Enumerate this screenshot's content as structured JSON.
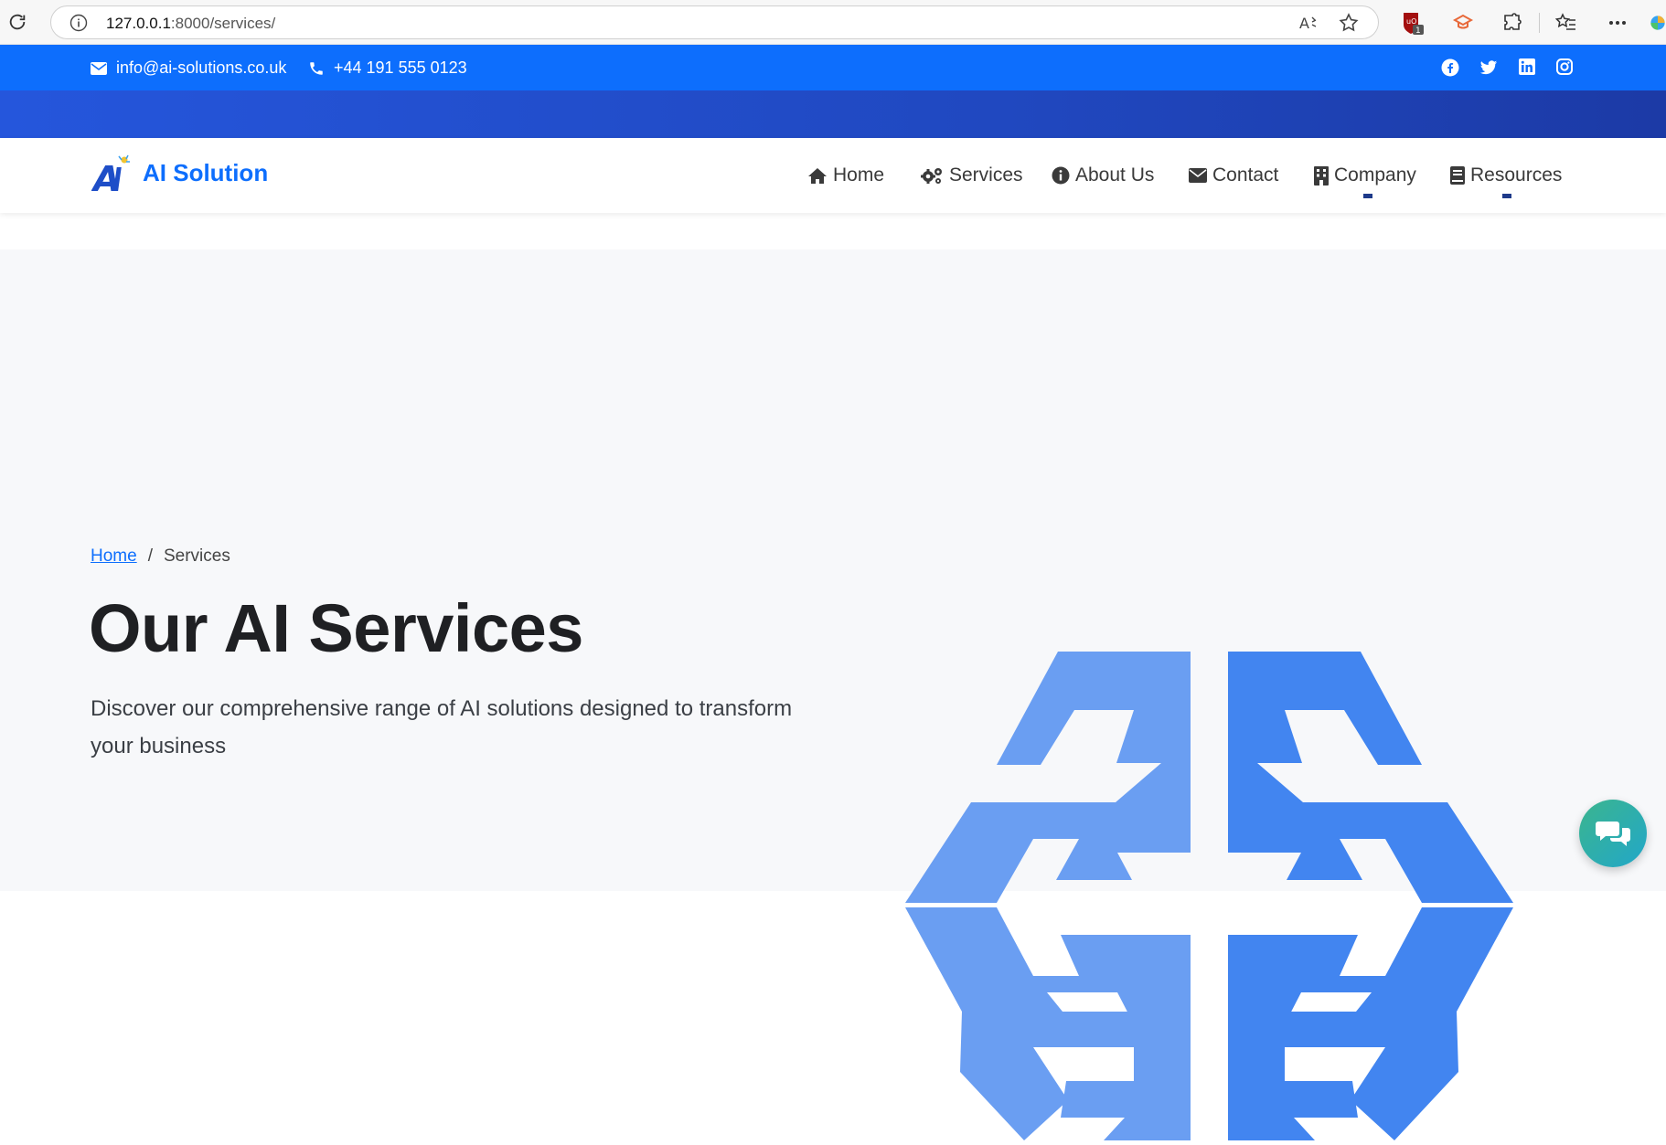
{
  "browser": {
    "url_host": "127.0.0.1",
    "url_path": ":8000/services/",
    "read_aloud": "Aͅ",
    "ext_badge": "1"
  },
  "topbar": {
    "email": "info@ai-solutions.co.uk",
    "phone": "+44 191 555 0123",
    "socials": [
      "facebook-icon",
      "twitter-icon",
      "linkedin-icon",
      "instagram-icon"
    ]
  },
  "brand": {
    "name": "AI Solution",
    "logo_text": "Ai"
  },
  "nav": {
    "home": "Home",
    "services": "Services",
    "about": "About Us",
    "contact": "Contact",
    "company": "Company",
    "resources": "Resources"
  },
  "hero": {
    "breadcrumb_home": "Home",
    "breadcrumb_sep": "/",
    "breadcrumb_current": "Services",
    "title": "Our AI Services",
    "lead": "Discover our comprehensive range of AI solutions designed to transform your business"
  },
  "colors": {
    "primary": "#0d6efd",
    "brain_left": "#6a9ef2",
    "brain_right": "#4285f0",
    "chat_gradient_start": "#3bb58e",
    "chat_gradient_end": "#22a7c9"
  }
}
